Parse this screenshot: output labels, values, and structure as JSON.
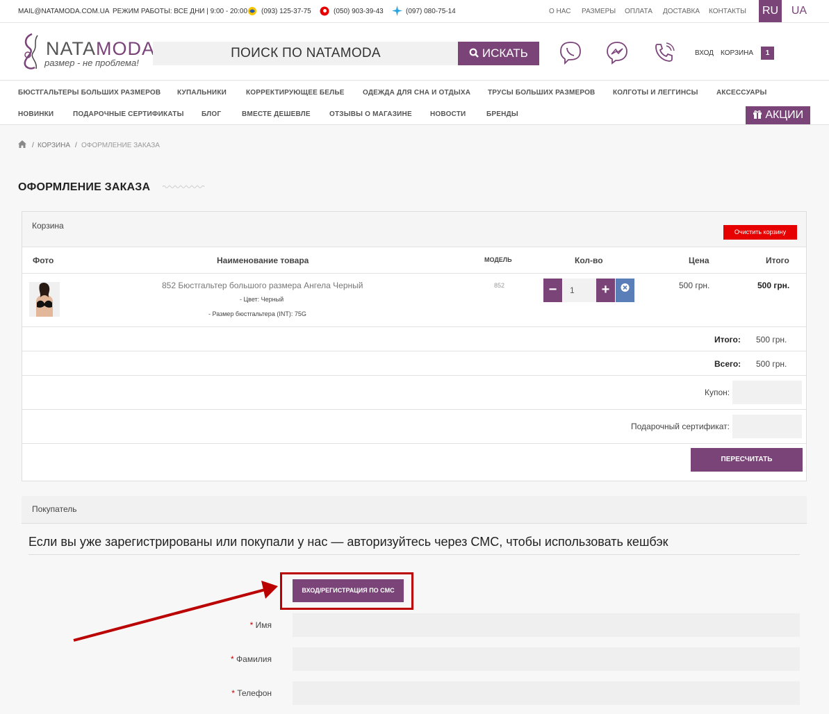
{
  "topbar": {
    "email": "MAIL@NATAMODA.COM.UA",
    "hours": "РЕЖИМ РАБОТЫ: ВСЕ ДНИ | 9:00 - 20:00",
    "phones": [
      "(093) 125-37-75",
      "(050) 903-39-43",
      "(097) 080-75-14"
    ],
    "nav": [
      "О НАС",
      "РАЗМЕРЫ",
      "ОПЛАТА",
      "ДОСТАВКА",
      "КОНТАКТЫ"
    ],
    "lang_ru": "RU",
    "lang_ua": "UA"
  },
  "header": {
    "logo_a": "NATA",
    "logo_b": "MODA",
    "slogan": "размер - не проблема!",
    "search_placeholder": "ПОИСК ПО NATAMODA",
    "search_button": "ИСКАТЬ",
    "login": "ВХОД",
    "cart": "КОРЗИНА",
    "cart_count": "1"
  },
  "menu": {
    "row1": [
      "БЮСТГАЛЬТЕРЫ БОЛЬШИХ РАЗМЕРОВ",
      "КУПАЛЬНИКИ",
      "КОРРЕКТИРУЮЩЕЕ БЕЛЬЕ",
      "ОДЕЖДА ДЛЯ СНА И ОТДЫХА",
      "ТРУСЫ БОЛЬШИХ РАЗМЕРОВ",
      "КОЛГОТЫ И ЛЕГГИНСЫ",
      "АКСЕССУАРЫ"
    ],
    "row2": [
      "НОВИНКИ",
      "ПОДАРОЧНЫЕ СЕРТИФИКАТЫ",
      "БЛОГ",
      "ВМЕСТЕ ДЕШЕВЛЕ",
      "ОТЗЫВЫ О МАГАЗИНЕ",
      "НОВОСТИ",
      "БРЕНДЫ"
    ],
    "promo": "АКЦИИ"
  },
  "breadcrumb": [
    "КОРЗИНА",
    "ОФОРМЛЕНИЕ ЗАКАЗА"
  ],
  "page_title": "ОФОРМЛЕНИЕ ЗАКАЗА",
  "cart": {
    "title": "Корзина",
    "clear": "Очистить корзину",
    "columns": [
      "Фото",
      "Наименование товара",
      "МОДЕЛЬ",
      "Кол-во",
      "Цена",
      "Итого"
    ],
    "item": {
      "name": "852 Бюстгальтер большого размера Ангела Черный",
      "option1": "- Цвет: Черный",
      "option2": "- Размер бюстгальтера (INT): 75G",
      "model": "852",
      "qty": "1",
      "price": "500 грн.",
      "total": "500 грн."
    },
    "subtotal_label": "Итого:",
    "subtotal": "500 грн.",
    "total_label": "Всего:",
    "total": "500 грн.",
    "coupon_label": "Купон:",
    "gift_label": "Подарочный сертификат:",
    "recalc": "ПЕРЕСЧИТАТЬ"
  },
  "buyer": {
    "title": "Покупатель",
    "sms_note": "Если вы уже зарегистрированы или покупали у нас — авторизуйтесь через СМС, чтобы использовать кешбэк",
    "sms_button": "ВХОД/РЕГИСТРАЦИЯ ПО СМС",
    "fields": [
      "Имя",
      "Фамилия",
      "Телефон"
    ],
    "required_mark": "*"
  },
  "colors": {
    "accent": "#7b4479",
    "danger": "#e60000",
    "highlight": "#b00000"
  }
}
